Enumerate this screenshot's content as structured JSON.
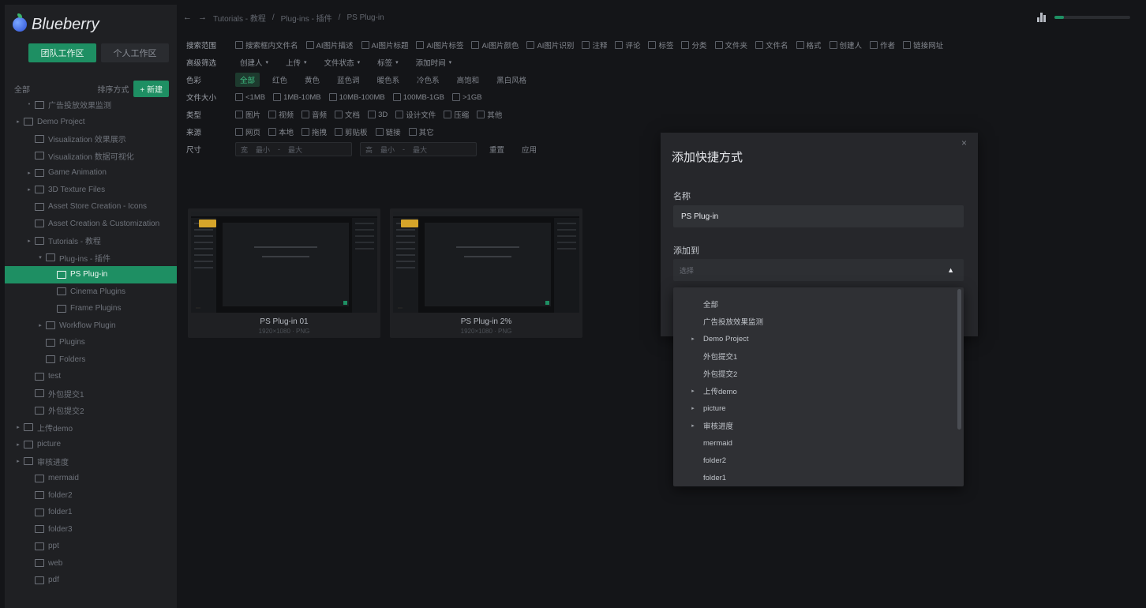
{
  "app": {
    "name": "Blueberry"
  },
  "sidebar": {
    "tabs": [
      {
        "label": "团队工作区",
        "active": true
      },
      {
        "label": "个人工作区",
        "active": false
      }
    ],
    "tree_header": {
      "label": "全部",
      "sort_label": "排序方式",
      "new_button": "+ 新建"
    },
    "items": [
      {
        "label": "广告投放效果监测",
        "depth": 1,
        "caret": "•",
        "selected": false
      },
      {
        "label": "Demo Project",
        "depth": 0,
        "caret": "▸",
        "selected": false
      },
      {
        "label": "Visualization 效果展示",
        "depth": 1,
        "caret": "",
        "selected": false
      },
      {
        "label": "Visualization 数据可视化",
        "depth": 1,
        "caret": "",
        "selected": false
      },
      {
        "label": "Game Animation",
        "depth": 1,
        "caret": "▸",
        "selected": false
      },
      {
        "label": "3D Texture Files",
        "depth": 1,
        "caret": "▸",
        "selected": false
      },
      {
        "label": "Asset Store Creation - Icons",
        "depth": 1,
        "caret": "",
        "selected": false
      },
      {
        "label": "Asset Creation & Customization",
        "depth": 1,
        "caret": "",
        "selected": false
      },
      {
        "label": "Tutorials - 教程",
        "depth": 1,
        "caret": "▸",
        "selected": false
      },
      {
        "label": "Plug-ins - 插件",
        "depth": 2,
        "caret": "▾",
        "selected": false
      },
      {
        "label": "PS Plug-in",
        "depth": 3,
        "caret": "",
        "selected": true
      },
      {
        "label": "Cinema Plugins",
        "depth": 3,
        "caret": "",
        "selected": false
      },
      {
        "label": "Frame Plugins",
        "depth": 3,
        "caret": "",
        "selected": false
      },
      {
        "label": "Workflow Plugin",
        "depth": 2,
        "caret": "▸",
        "selected": false
      },
      {
        "label": "Plugins",
        "depth": 2,
        "caret": "",
        "selected": false
      },
      {
        "label": "Folders",
        "depth": 2,
        "caret": "",
        "selected": false
      },
      {
        "label": "test",
        "depth": 1,
        "caret": "",
        "selected": false
      },
      {
        "label": "外包提交1",
        "depth": 1,
        "caret": "",
        "selected": false
      },
      {
        "label": "外包提交2",
        "depth": 1,
        "caret": "",
        "selected": false
      },
      {
        "label": "上传demo",
        "depth": 0,
        "caret": "▸",
        "selected": false
      },
      {
        "label": "picture",
        "depth": 0,
        "caret": "▸",
        "selected": false
      },
      {
        "label": "审核进度",
        "depth": 0,
        "caret": "▸",
        "selected": false
      },
      {
        "label": "mermaid",
        "depth": 1,
        "caret": "",
        "selected": false
      },
      {
        "label": "folder2",
        "depth": 1,
        "caret": "",
        "selected": false
      },
      {
        "label": "folder1",
        "depth": 1,
        "caret": "",
        "selected": false
      },
      {
        "label": "folder3",
        "depth": 1,
        "caret": "",
        "selected": false
      },
      {
        "label": "ppt",
        "depth": 1,
        "caret": "",
        "selected": false
      },
      {
        "label": "web",
        "depth": 1,
        "caret": "",
        "selected": false
      },
      {
        "label": "pdf",
        "depth": 1,
        "caret": "",
        "selected": false
      }
    ]
  },
  "topbar": {
    "back": "←",
    "forward": "→",
    "breadcrumb": [
      "Tutorials - 教程",
      "Plug-ins - 插件",
      "PS Plug-in"
    ],
    "progress": 0.12
  },
  "filters": {
    "rows": [
      {
        "label": "搜索范围",
        "kind": "checks",
        "items": [
          "搜索框内文件名",
          "AI图片描述",
          "AI图片标题",
          "AI图片标签",
          "AI图片颜色",
          "AI图片识别",
          "注释",
          "评论",
          "标签",
          "分类",
          "文件夹",
          "文件名",
          "格式",
          "创建人",
          "作者",
          "链接网址"
        ]
      },
      {
        "label": "高级筛选",
        "kind": "drops",
        "items": [
          "创建人",
          "上传",
          "文件状态",
          "标签",
          "添加时间"
        ]
      },
      {
        "label": "色彩",
        "kind": "tags",
        "items": [
          "全部",
          "红色",
          "黄色",
          "蓝色调",
          "暖色系",
          "冷色系",
          "高饱和",
          "黑白风格"
        ]
      },
      {
        "label": "文件大小",
        "kind": "checks",
        "items": [
          "<1MB",
          "1MB-10MB",
          "10MB-100MB",
          "100MB-1GB",
          ">1GB"
        ]
      },
      {
        "label": "类型",
        "kind": "checks",
        "items": [
          "图片",
          "视频",
          "音频",
          "文档",
          "3D",
          "设计文件",
          "压缩",
          "其他"
        ]
      },
      {
        "label": "来源",
        "kind": "checks",
        "items": [
          "网页",
          "本地",
          "拖拽",
          "剪贴板",
          "链接",
          "其它"
        ]
      }
    ],
    "size_row": {
      "label": "尺寸",
      "width_label": "宽",
      "height_label": "高",
      "min_placeholder": "最小",
      "max_placeholder": "最大",
      "reset": "重置",
      "apply": "应用"
    }
  },
  "grid": {
    "cards": [
      {
        "name": "PS Plug-in 01",
        "meta": "1920×1080 · PNG"
      },
      {
        "name": "PS Plug-in 2%",
        "meta": "1920×1080 · PNG"
      }
    ]
  },
  "modal": {
    "title": "添加快捷方式",
    "close": "×",
    "name_label": "名称",
    "name_value": "PS Plug-in",
    "location_label": "添加到",
    "location_placeholder": "选择",
    "options": [
      {
        "label": "全部",
        "caret": ""
      },
      {
        "label": "广告投放效果监测",
        "caret": ""
      },
      {
        "label": "Demo Project",
        "caret": "▸"
      },
      {
        "label": "外包提交1",
        "caret": ""
      },
      {
        "label": "外包提交2",
        "caret": ""
      },
      {
        "label": "上传demo",
        "caret": "▸"
      },
      {
        "label": "picture",
        "caret": "▸"
      },
      {
        "label": "审核进度",
        "caret": "▸"
      },
      {
        "label": "mermaid",
        "caret": ""
      },
      {
        "label": "folder2",
        "caret": ""
      },
      {
        "label": "folder1",
        "caret": ""
      }
    ]
  },
  "colors": {
    "accent": "#1e8f63",
    "panel": "#26272b",
    "sidebar": "#1f2023",
    "background": "#141518"
  }
}
